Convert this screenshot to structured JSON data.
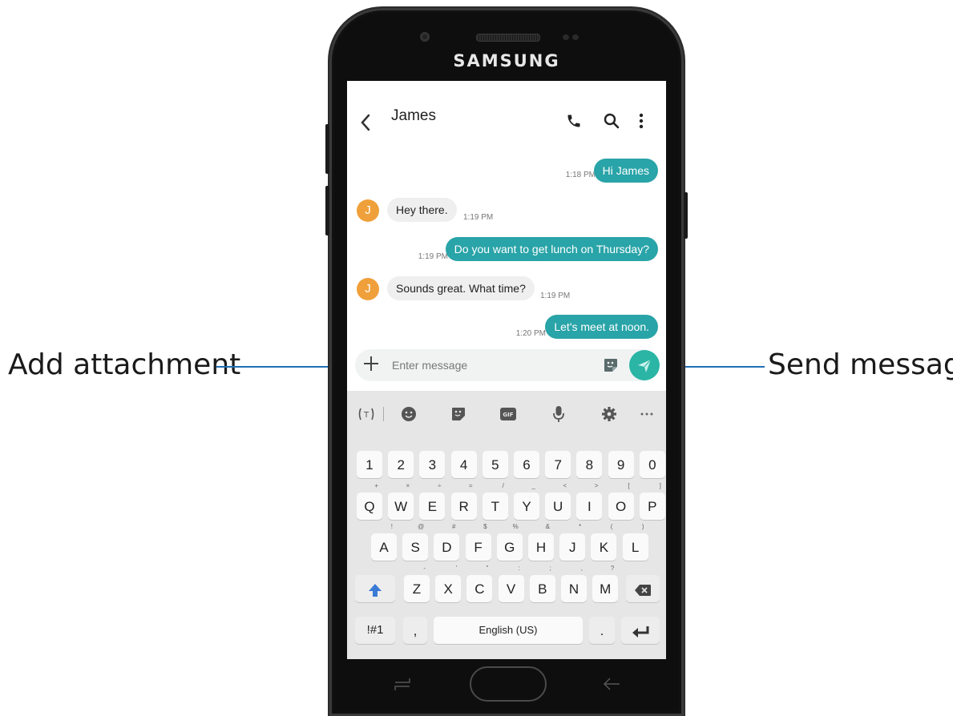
{
  "callouts": {
    "left": "Add attachment",
    "right": "Send message"
  },
  "device": {
    "brand": "SAMSUNG"
  },
  "header": {
    "title": "James",
    "icons": [
      "back-arrow-icon",
      "phone-icon",
      "search-icon",
      "more-options-icon"
    ]
  },
  "messages": [
    {
      "dir": "out",
      "text": "Hi James",
      "time": "1:18 PM"
    },
    {
      "dir": "in",
      "avatar": "J",
      "text": "Hey there.",
      "time": "1:19 PM"
    },
    {
      "dir": "out",
      "text": "Do you want to get lunch on Thursday?",
      "time": "1:19 PM"
    },
    {
      "dir": "in",
      "avatar": "J",
      "text": "Sounds great. What time?",
      "time": "1:19 PM"
    },
    {
      "dir": "out",
      "text": "Let's meet at noon.",
      "time": "1:20 PM"
    }
  ],
  "composer": {
    "placeholder": "Enter message",
    "icons": [
      "plus-icon",
      "sticker-icon",
      "send-icon"
    ]
  },
  "keyboard": {
    "toolbar_icons": [
      "translate-icon",
      "emoji-icon",
      "sticker-icon",
      "gif-icon",
      "mic-icon",
      "settings-icon",
      "more-icon"
    ],
    "gif_label": "GIF",
    "row_numbers": [
      "1",
      "2",
      "3",
      "4",
      "5",
      "6",
      "7",
      "8",
      "9",
      "0"
    ],
    "row_top": [
      {
        "k": "Q",
        "h": "+"
      },
      {
        "k": "W",
        "h": "×"
      },
      {
        "k": "E",
        "h": "÷"
      },
      {
        "k": "R",
        "h": "="
      },
      {
        "k": "T",
        "h": "/"
      },
      {
        "k": "Y",
        "h": "_"
      },
      {
        "k": "U",
        "h": "<"
      },
      {
        "k": "I",
        "h": ">"
      },
      {
        "k": "O",
        "h": "["
      },
      {
        "k": "P",
        "h": "]"
      }
    ],
    "row_mid": [
      {
        "k": "A",
        "h": "!"
      },
      {
        "k": "S",
        "h": "@"
      },
      {
        "k": "D",
        "h": "#"
      },
      {
        "k": "F",
        "h": "$"
      },
      {
        "k": "G",
        "h": "%"
      },
      {
        "k": "H",
        "h": "&"
      },
      {
        "k": "J",
        "h": "*"
      },
      {
        "k": "K",
        "h": "("
      },
      {
        "k": "L",
        "h": ")"
      }
    ],
    "row_bottom": [
      {
        "k": "Z",
        "h": "-"
      },
      {
        "k": "X",
        "h": "'"
      },
      {
        "k": "C",
        "h": "\""
      },
      {
        "k": "V",
        "h": ":"
      },
      {
        "k": "B",
        "h": ";"
      },
      {
        "k": "N",
        "h": ","
      },
      {
        "k": "M",
        "h": "?"
      }
    ],
    "symbols_label": "!#1",
    "comma_label": ",",
    "space_label": "English (US)",
    "period_label": ".",
    "accent_color": "#3a7bd5"
  },
  "colors": {
    "bubble_out": "#29a4a8",
    "bubble_in": "#efefef",
    "avatar": "#f0a03a",
    "send_button": "#2ab5a5",
    "callout_line": "#1f6fb5"
  }
}
